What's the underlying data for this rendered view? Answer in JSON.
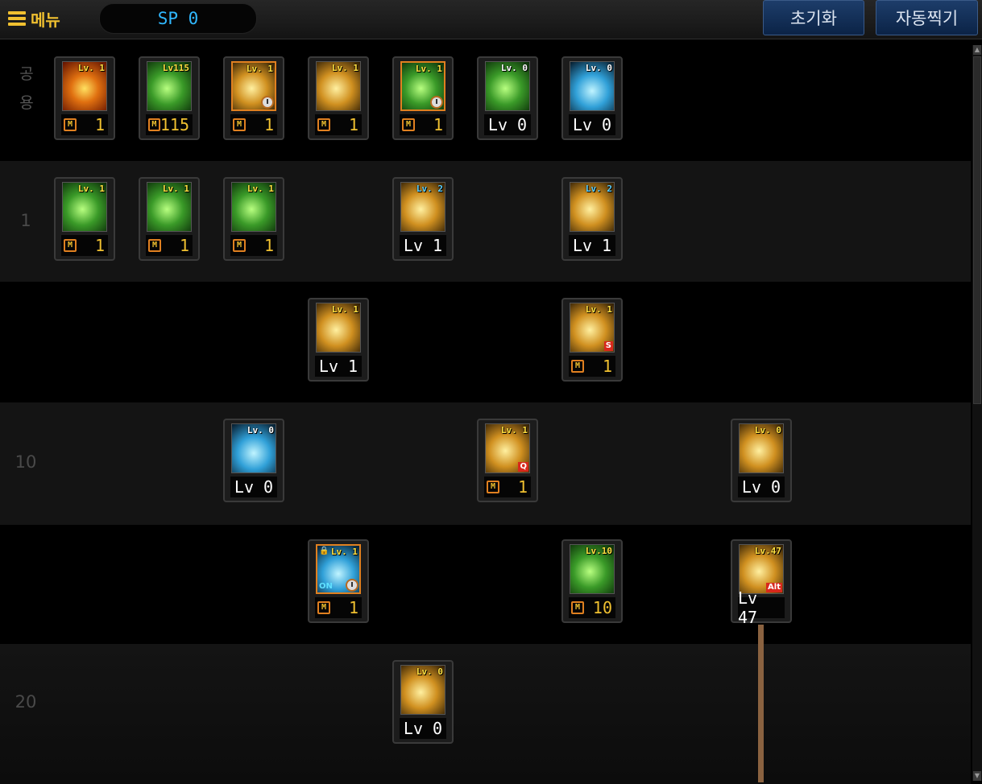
{
  "header": {
    "menu_label": "메뉴",
    "sp_label": "SP 0",
    "reset_label": "초기화",
    "auto_label": "자동찍기"
  },
  "rows": [
    {
      "label": "공\n용"
    },
    {
      "label": "1"
    },
    {
      "label": ""
    },
    {
      "label": "10"
    },
    {
      "label": ""
    },
    {
      "label": "20"
    }
  ],
  "skills": [
    {
      "name": "fire-burst",
      "tag": "Lv. 1",
      "value": "1",
      "mastered": true,
      "palette": "fire"
    },
    {
      "name": "green-rush",
      "tag": "Lv115",
      "value": "115",
      "mastered": true,
      "palette": "green"
    },
    {
      "name": "gold-dash",
      "tag": "Lv. 1",
      "value": "1",
      "mastered": true,
      "palette": "gold"
    },
    {
      "name": "gold-slide",
      "tag": "Lv. 1",
      "value": "1",
      "mastered": true,
      "palette": "gold"
    },
    {
      "name": "green-dash",
      "tag": "Lv. 1",
      "value": "1",
      "mastered": true,
      "palette": "green"
    },
    {
      "name": "green-target",
      "tag": "Lv. 0",
      "value": "Lv 0",
      "mastered": false,
      "palette": "green"
    },
    {
      "name": "blue-wings",
      "tag": "Lv. 0",
      "value": "Lv 0",
      "mastered": false,
      "palette": "blue"
    },
    {
      "name": "green-hand",
      "tag": "Lv. 1",
      "value": "1",
      "mastered": true,
      "palette": "green"
    },
    {
      "name": "green-aura",
      "tag": "Lv. 1",
      "value": "1",
      "mastered": true,
      "palette": "green"
    },
    {
      "name": "green-spark",
      "tag": "Lv. 1",
      "value": "1",
      "mastered": true,
      "palette": "green"
    },
    {
      "name": "gold-wind",
      "tag": "Lv. 2",
      "value": "Lv 1",
      "mastered": false,
      "palette": "gold"
    },
    {
      "name": "gold-tornado",
      "tag": "Lv. 2",
      "value": "Lv 1",
      "mastered": false,
      "palette": "gold"
    },
    {
      "name": "gold-kick",
      "tag": "Lv. 1",
      "value": "Lv 1",
      "mastered": false,
      "palette": "gold"
    },
    {
      "name": "gold-vortex",
      "tag": "Lv. 1",
      "value": "1",
      "mastered": true,
      "palette": "gold"
    },
    {
      "name": "blue-flame",
      "tag": "Lv. 0",
      "value": "Lv 0",
      "mastered": false,
      "palette": "blue"
    },
    {
      "name": "gold-duo",
      "tag": "Lv. 1",
      "value": "1",
      "mastered": true,
      "palette": "gold"
    },
    {
      "name": "gold-cloud",
      "tag": "Lv. 0",
      "value": "Lv 0",
      "mastered": false,
      "palette": "gold"
    },
    {
      "name": "blue-explosion",
      "tag": "Lv. 1",
      "value": "1",
      "mastered": true,
      "palette": "blue"
    },
    {
      "name": "green-leaf",
      "tag": "Lv.10",
      "value": "10",
      "mastered": true,
      "palette": "green"
    },
    {
      "name": "gold-spike",
      "tag": "Lv.47",
      "value": "Lv 47",
      "mastered": false,
      "palette": "gold"
    },
    {
      "name": "gold-arrows",
      "tag": "Lv. 0",
      "value": "Lv 0",
      "mastered": false,
      "palette": "gold"
    }
  ],
  "badges": {
    "mastery_mark": "M",
    "s_mark": "S",
    "q_mark": "Q",
    "alt_mark": "Alt",
    "on_mark": "ON"
  },
  "colors": {
    "fire": "#c85010",
    "green": "#3a8a2a",
    "gold": "#b88a20",
    "blue": "#1a5a8a"
  }
}
